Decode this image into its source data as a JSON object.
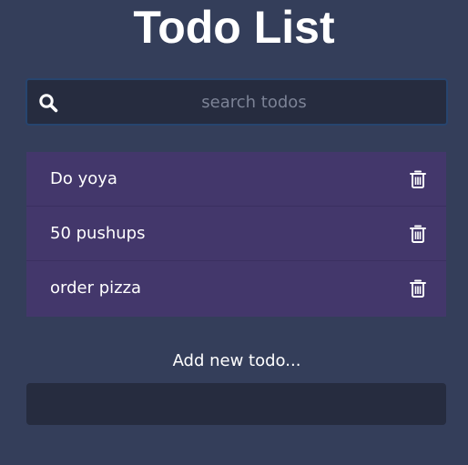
{
  "header": {
    "title": "Todo List"
  },
  "search": {
    "placeholder": "search todos",
    "value": "",
    "icon": "search-icon"
  },
  "todos": [
    {
      "label": "Do yoya",
      "icon": "trash-icon"
    },
    {
      "label": "50 pushups",
      "icon": "trash-icon"
    },
    {
      "label": "order pizza",
      "icon": "trash-icon"
    }
  ],
  "add_form": {
    "label": "Add new todo...",
    "value": ""
  },
  "colors": {
    "background": "#343e5a",
    "input_background": "#262c3f",
    "item_background": "#43376b",
    "search_border": "#27456f",
    "text": "#ffffff"
  }
}
